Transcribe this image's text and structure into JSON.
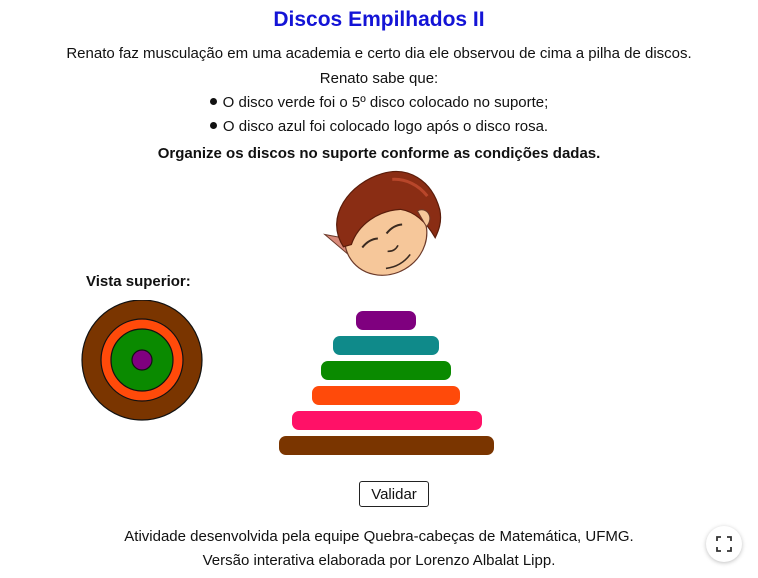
{
  "title": "Discos Empilhados II",
  "intro": "Renato faz musculação em uma academia e certo dia ele observou de cima a pilha de discos.",
  "knows": "Renato sabe que:",
  "conditions": [
    "O disco verde foi o 5º disco colocado no suporte;",
    "O disco azul foi colocado logo após o disco rosa."
  ],
  "instruction": "Organize os discos no suporte conforme as condições dadas.",
  "top_view_label": "Vista superior:",
  "top_view_rings": [
    {
      "color": "brown",
      "hex": "#7a3500"
    },
    {
      "color": "orange",
      "hex": "#ff4a0a"
    },
    {
      "color": "green",
      "hex": "#0a8a00"
    },
    {
      "color": "purple",
      "hex": "#7f007f"
    }
  ],
  "stack_discs": [
    {
      "color": "purple",
      "hex": "#7f007f"
    },
    {
      "color": "teal",
      "hex": "#0f8a8a"
    },
    {
      "color": "green",
      "hex": "#0a8a00"
    },
    {
      "color": "orange",
      "hex": "#ff4a0a"
    },
    {
      "color": "pink",
      "hex": "#ff1167"
    },
    {
      "color": "brown",
      "hex": "#7a3500"
    }
  ],
  "validate_label": "Validar",
  "credits": [
    "Atividade desenvolvida pela equipe Quebra-cabeças de Matemática, UFMG.",
    "Versão interativa elaborada por Lorenzo Albalat Lipp."
  ],
  "colors": {
    "title": "#1414d6"
  },
  "icons": {
    "character": "person-head-icon",
    "fullscreen": "fullscreen-icon"
  }
}
